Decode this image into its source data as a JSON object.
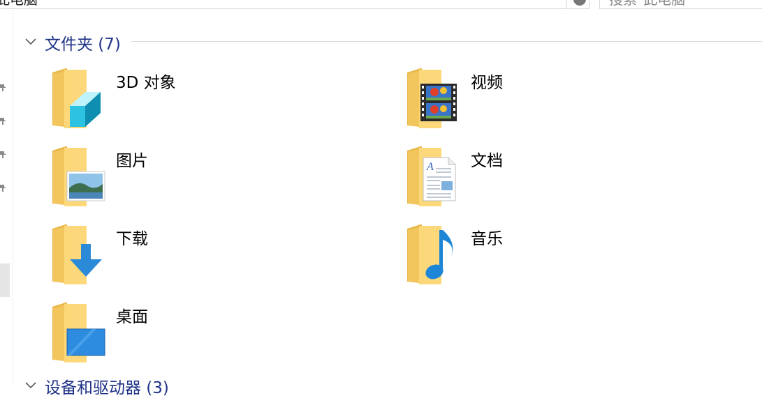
{
  "address": {
    "path_text": "此电脑",
    "search_placeholder": "搜索\"此电脑\""
  },
  "groups": [
    {
      "title": "文件夹 (7)"
    },
    {
      "title": "设备和驱动器 (3)"
    }
  ],
  "folders": [
    {
      "label": "3D 对象",
      "icon": "3d-objects-folder-icon"
    },
    {
      "label": "视频",
      "icon": "videos-folder-icon"
    },
    {
      "label": "图片",
      "icon": "pictures-folder-icon"
    },
    {
      "label": "文档",
      "icon": "documents-folder-icon"
    },
    {
      "label": "下载",
      "icon": "downloads-folder-icon"
    },
    {
      "label": "音乐",
      "icon": "music-folder-icon"
    },
    {
      "label": "桌面",
      "icon": "desktop-folder-icon"
    }
  ],
  "colors": {
    "group_title": "#1e3287",
    "folder_back": "#e8b84a",
    "folder_front": "#fcd87a"
  }
}
